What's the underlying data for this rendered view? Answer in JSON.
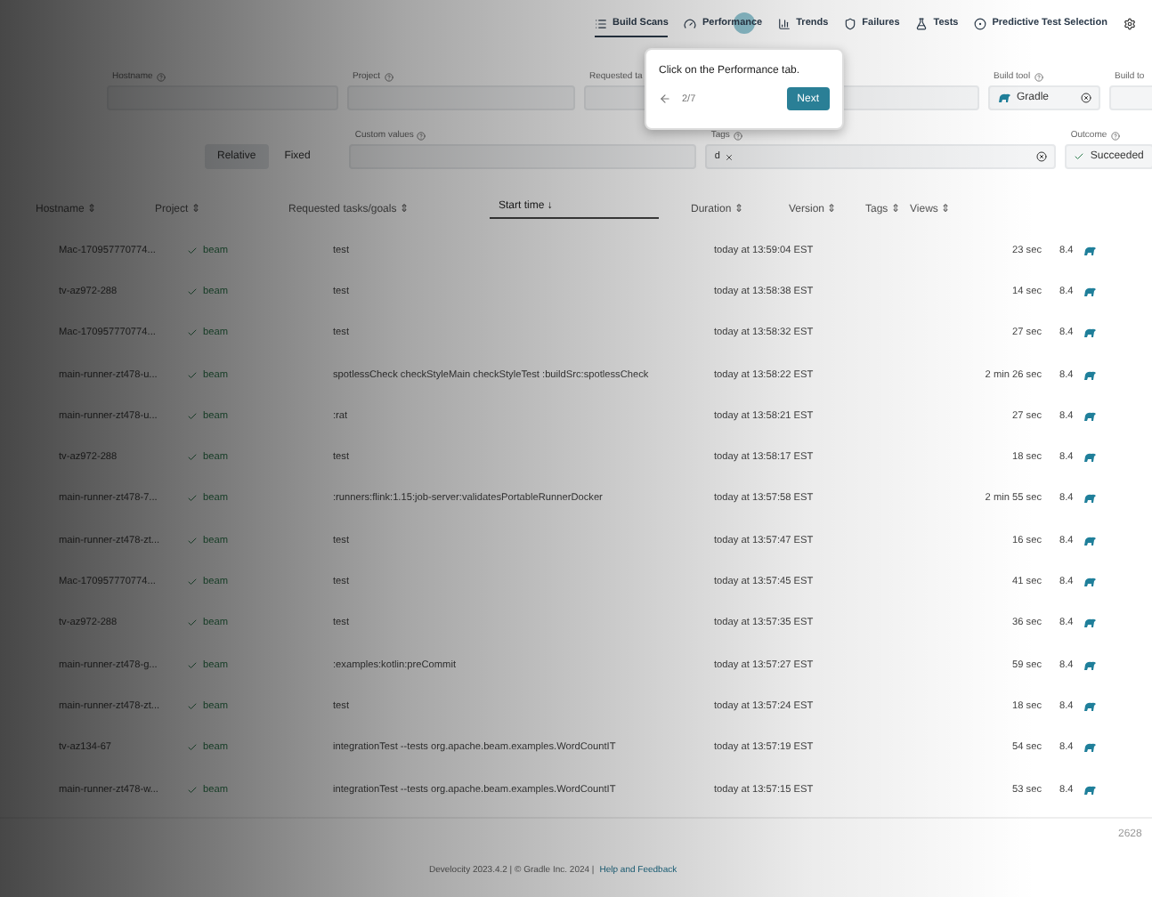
{
  "nav": {
    "tabs": [
      {
        "label": "Build Scans",
        "selected": true
      },
      {
        "label": "Performance",
        "selected": false
      },
      {
        "label": "Trends",
        "selected": false
      },
      {
        "label": "Failures",
        "selected": false
      },
      {
        "label": "Tests",
        "selected": false
      },
      {
        "label": "Predictive Test Selection",
        "selected": false
      }
    ]
  },
  "tour_popup": {
    "message": "Click on the Performance tab.",
    "step": "2/7",
    "button": "Next"
  },
  "filters": {
    "row1": [
      {
        "label": "Hostname",
        "has_help": true
      },
      {
        "label": "Project",
        "has_help": true
      },
      {
        "label": "Requested ta"
      },
      {
        "label": "Build tool",
        "has_help": true,
        "value": "Gradle"
      },
      {
        "label": "Build to",
        "has_help": false
      }
    ],
    "time_mode": [
      {
        "label": "Relative",
        "selected": true
      },
      {
        "label": "Fixed",
        "selected": false
      }
    ],
    "custom_values": {
      "label": "Custom values"
    },
    "tags": {
      "label": "Tags",
      "chips": [
        "d"
      ]
    },
    "outcome": {
      "label": "Outcome",
      "value": "Succeeded"
    }
  },
  "table": {
    "columns": [
      {
        "label": "Hostname",
        "sort_glyph": "⇕",
        "selected": false
      },
      {
        "label": "Project",
        "sort_glyph": "⇕",
        "selected": false
      },
      {
        "label": "Requested tasks/goals",
        "sort_glyph": "⇕",
        "selected": false
      },
      {
        "label": "Start time",
        "sort_glyph": "↓",
        "selected": true
      },
      {
        "label": "Duration",
        "sort_glyph": "⇕",
        "selected": false
      },
      {
        "label": "Version",
        "sort_glyph": "⇕",
        "selected": false
      },
      {
        "label": "Tags",
        "sort_glyph": "⇕",
        "selected": false
      },
      {
        "label": "Views",
        "sort_glyph": "⇕",
        "selected": false
      }
    ],
    "rows": [
      {
        "hostname": "Mac-170957770774...",
        "project": "beam",
        "tasks": "test",
        "start": "today at 13:59:04 EST",
        "duration": "23 sec",
        "version": "8.4"
      },
      {
        "hostname": "tv-az972-288",
        "project": "beam",
        "tasks": "test",
        "start": "today at 13:58:38 EST",
        "duration": "14 sec",
        "version": "8.4"
      },
      {
        "hostname": "Mac-170957770774...",
        "project": "beam",
        "tasks": "test",
        "start": "today at 13:58:32 EST",
        "duration": "27 sec",
        "version": "8.4"
      },
      {
        "hostname": "main-runner-zt478-u...",
        "project": "beam",
        "tasks": "spotlessCheck checkStyleMain checkStyleTest :buildSrc:spotlessCheck",
        "start": "today at 13:58:22 EST",
        "duration": "2 min 26 sec",
        "version": "8.4"
      },
      {
        "hostname": "main-runner-zt478-u...",
        "project": "beam",
        "tasks": ":rat",
        "start": "today at 13:58:21 EST",
        "duration": "27 sec",
        "version": "8.4"
      },
      {
        "hostname": "tv-az972-288",
        "project": "beam",
        "tasks": "test",
        "start": "today at 13:58:17 EST",
        "duration": "18 sec",
        "version": "8.4"
      },
      {
        "hostname": "main-runner-zt478-7...",
        "project": "beam",
        "tasks": ":runners:flink:1.15:job-server:validatesPortableRunnerDocker",
        "start": "today at 13:57:58 EST",
        "duration": "2 min 55 sec",
        "version": "8.4"
      },
      {
        "hostname": "main-runner-zt478-zt...",
        "project": "beam",
        "tasks": "test",
        "start": "today at 13:57:47 EST",
        "duration": "16 sec",
        "version": "8.4"
      },
      {
        "hostname": "Mac-170957770774...",
        "project": "beam",
        "tasks": "test",
        "start": "today at 13:57:45 EST",
        "duration": "41 sec",
        "version": "8.4"
      },
      {
        "hostname": "tv-az972-288",
        "project": "beam",
        "tasks": "test",
        "start": "today at 13:57:35 EST",
        "duration": "36 sec",
        "version": "8.4"
      },
      {
        "hostname": "main-runner-zt478-g...",
        "project": "beam",
        "tasks": ":examples:kotlin:preCommit",
        "start": "today at 13:57:27 EST",
        "duration": "59 sec",
        "version": "8.4"
      },
      {
        "hostname": "main-runner-zt478-zt...",
        "project": "beam",
        "tasks": "test",
        "start": "today at 13:57:24 EST",
        "duration": "18 sec",
        "version": "8.4"
      },
      {
        "hostname": "tv-az134-67",
        "project": "beam",
        "tasks": "integrationTest --tests org.apache.beam.examples.WordCountIT",
        "start": "today at 13:57:19 EST",
        "duration": "54 sec",
        "version": "8.4"
      },
      {
        "hostname": "main-runner-zt478-w...",
        "project": "beam",
        "tasks": "integrationTest --tests org.apache.beam.examples.WordCountIT",
        "start": "today at 13:57:15 EST",
        "duration": "53 sec",
        "version": "8.4"
      }
    ],
    "count": "2628"
  },
  "footer": {
    "text": "Develocity 2023.4.2 | © Gradle Inc. 2024 |",
    "link": "Help and Feedback"
  }
}
